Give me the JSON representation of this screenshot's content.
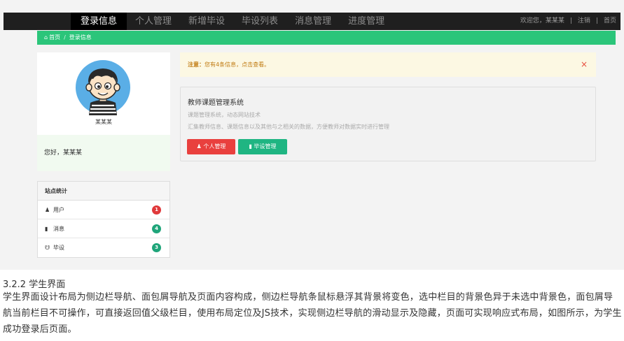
{
  "nav": {
    "items": [
      {
        "label": "登录信息",
        "active": true
      },
      {
        "label": "个人管理",
        "active": false
      },
      {
        "label": "新增毕设",
        "active": false
      },
      {
        "label": "毕设列表",
        "active": false
      },
      {
        "label": "消息管理",
        "active": false
      },
      {
        "label": "进度管理",
        "active": false
      }
    ],
    "welcome": "欢迎您，某某某",
    "logout": "注销",
    "home": "首页",
    "separator": "|"
  },
  "breadcrumb": {
    "home": "首页",
    "separator": "/",
    "current": "登录信息"
  },
  "profile": {
    "name": "某某某",
    "greeting": "您好，某某某"
  },
  "stats": {
    "title": "站点统计",
    "rows": [
      {
        "label": "用户",
        "icon": "user-icon",
        "count": "1",
        "color": "#e0393b"
      },
      {
        "label": "消息",
        "icon": "file-icon",
        "count": "4",
        "color": "#1fa57a"
      },
      {
        "label": "毕设",
        "icon": "cart-icon",
        "count": "3",
        "color": "#1fa57a"
      }
    ]
  },
  "alert": {
    "strong": "注意：",
    "text": "您有4条信息，点击查看。",
    "close": "×"
  },
  "panel": {
    "title": "教师课题管理系统",
    "line1": "课题管理系统，动态网站技术",
    "line2": "汇集教师信息、课题信息以及其他与之相关的数据，方便教师对数据实时进行管理",
    "btn_personal": "个人管理",
    "btn_thesis": "毕设管理"
  },
  "below": {
    "heading": "3.2.2 学生界面",
    "paragraph": "学生界面设计布局为侧边栏导航、面包屑导航及页面内容构成，侧边栏导航条鼠标悬浮其背景将变色，选中栏目的背景色异于未选中背景色，面包屑导航当前栏目不可操作，可直接返回值父级栏目，使用布局定位及JS技术，实现侧边栏导航的滑动显示及隐藏，页面可实现响应式布局，如图所示，为学生成功登录后页面。"
  },
  "colors": {
    "topbar": "#1f1f1f",
    "breadcrumb": "#2bc57a",
    "alert_bg": "#fcf8e3",
    "btn_red": "#e9403e",
    "btn_green": "#1fb582"
  }
}
